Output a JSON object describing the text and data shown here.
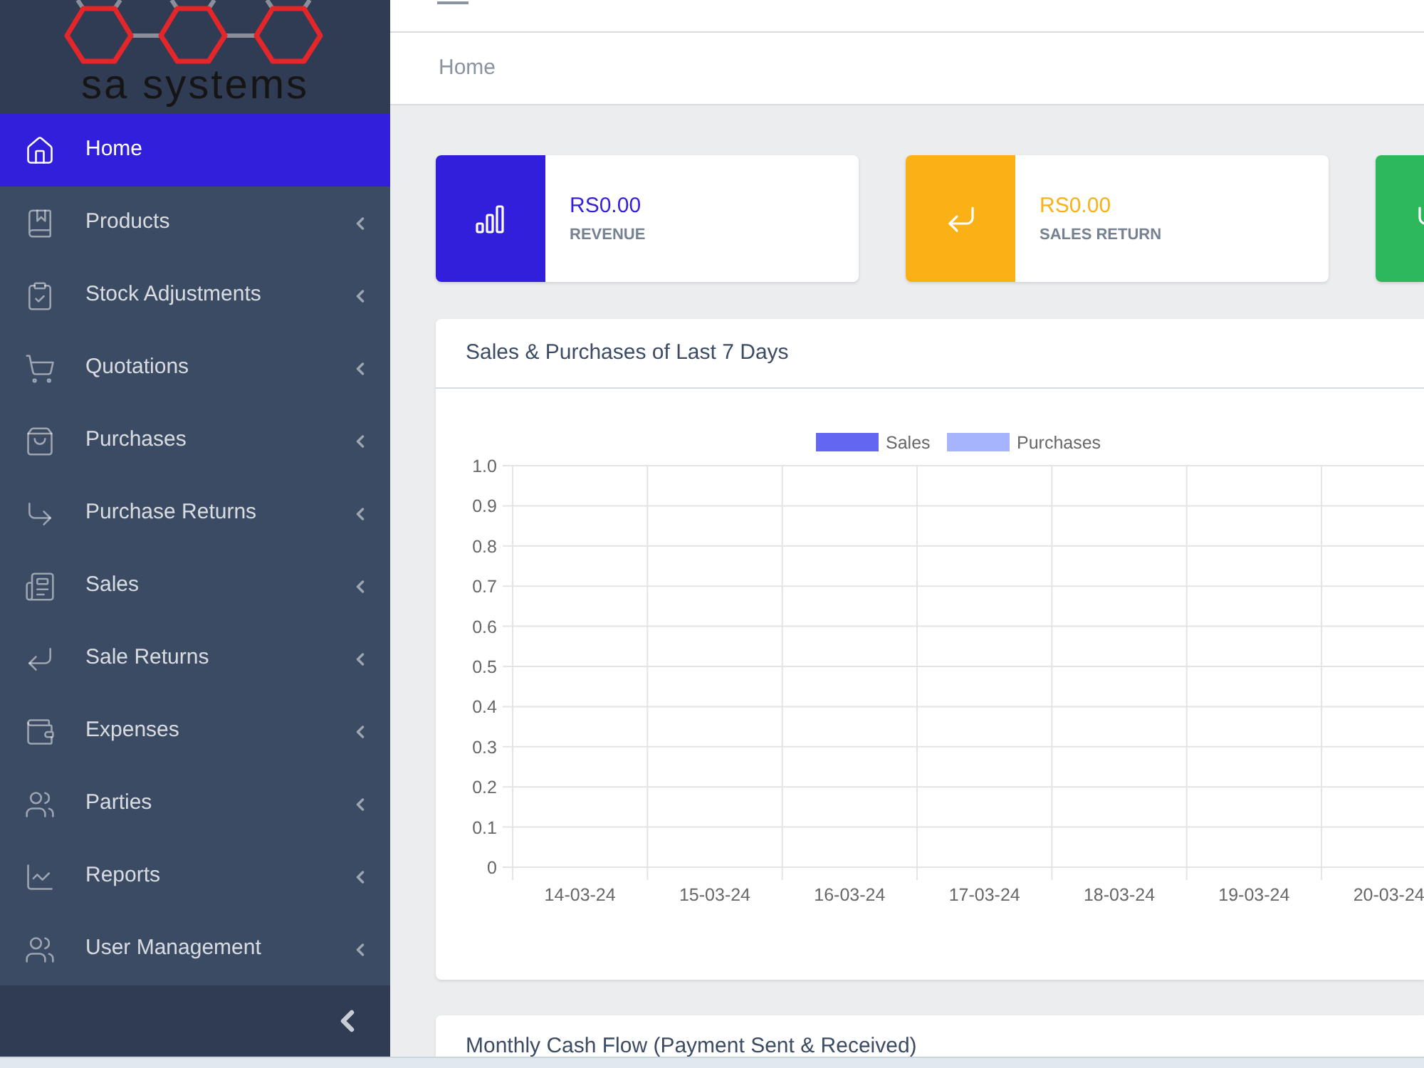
{
  "brand": {
    "name": "sa systems"
  },
  "sidebar": {
    "items": [
      {
        "label": "Home",
        "kind": "link",
        "selected": true
      },
      {
        "label": "Products",
        "kind": "group",
        "selected": false
      },
      {
        "label": "Stock Adjustments",
        "kind": "group",
        "selected": false
      },
      {
        "label": "Quotations",
        "kind": "group",
        "selected": false
      },
      {
        "label": "Purchases",
        "kind": "group",
        "selected": false
      },
      {
        "label": "Purchase Returns",
        "kind": "group",
        "selected": false
      },
      {
        "label": "Sales",
        "kind": "group",
        "selected": false
      },
      {
        "label": "Sale Returns",
        "kind": "group",
        "selected": false
      },
      {
        "label": "Expenses",
        "kind": "group",
        "selected": false
      },
      {
        "label": "Parties",
        "kind": "group",
        "selected": false
      },
      {
        "label": "Reports",
        "kind": "group",
        "selected": false
      },
      {
        "label": "User Management",
        "kind": "group",
        "selected": false
      }
    ]
  },
  "breadcrumb": [
    "Home"
  ],
  "stat_cards": [
    {
      "value": "RS0.00",
      "label": "REVENUE",
      "color": "#321fdb"
    },
    {
      "value": "RS0.00",
      "label": "SALES RETURN",
      "color": "#f9b115"
    },
    {
      "color": "#2eb85c"
    }
  ],
  "panels": [
    {
      "title": "Sales & Purchases of Last 7 Days",
      "chart_data": {
        "type": "bar",
        "categories": [
          "14-03-24",
          "15-03-24",
          "16-03-24",
          "17-03-24",
          "18-03-24",
          "19-03-24",
          "20-03-24"
        ],
        "series": [
          {
            "name": "Sales",
            "color": "#6366f1",
            "values": [
              0,
              0,
              0,
              0,
              0,
              0,
              0
            ]
          },
          {
            "name": "Purchases",
            "color": "#a5b4fc",
            "values": [
              0,
              0,
              0,
              0,
              0,
              0,
              0
            ]
          }
        ],
        "ylim": [
          0,
          1
        ],
        "yticks": [
          {
            "value": 1,
            "label": "1.0"
          },
          0.9,
          0.8,
          0.7,
          0.6,
          0.5,
          0.4,
          0.3,
          0.2,
          0.1,
          0
        ],
        "grid": true
      }
    },
    {
      "title": "Monthly Cash Flow (Payment Sent & Received)"
    }
  ]
}
